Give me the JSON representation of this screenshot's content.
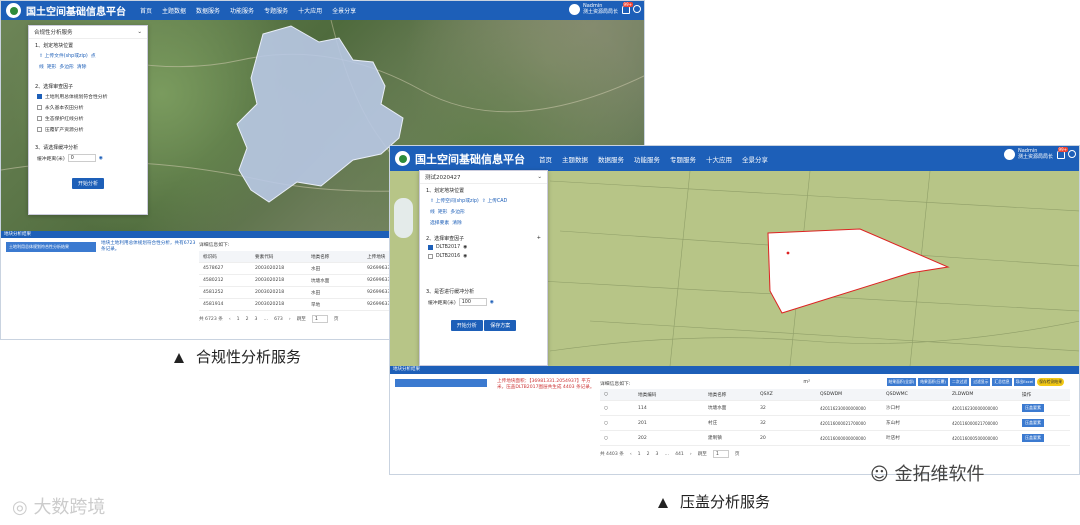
{
  "app_title": "国土空间基础信息平台",
  "nav": [
    "首页",
    "主题数据",
    "数据服务",
    "功能服务",
    "专题服务",
    "十大应用",
    "全景分享"
  ],
  "user": {
    "name": "Nadmin",
    "org": "测土资源局局长"
  },
  "notify_count": "99+",
  "panel1": {
    "title": "合规性分析服务",
    "s1": "1、划定地块位置",
    "upload": "上传文件(shp或zip)",
    "pt": "点",
    "tools": [
      "线",
      "矩形",
      "多边形",
      "清除"
    ],
    "s2": "2、选择审查因子",
    "factors": [
      "土地利用总体规划符合性分析",
      "永久基本农田分析",
      "生态保护红线分析",
      "压覆矿产资源分析"
    ],
    "s3": "3、请选择缓冲分析",
    "buffer_label": "缓冲距离(米)",
    "buffer_value": "0",
    "run": "开始分析"
  },
  "res1": {
    "title": "地块分析结果",
    "left_item": "土地利用总体规划符合性分析结果",
    "stat": "地块土地利用总体规划符合性分析，共有6723条记录。",
    "detail": "详细信息如下:",
    "headers": [
      "标识码",
      "要素代码",
      "地类名称",
      "上传地块"
    ],
    "rows": [
      [
        "4578627",
        "2003020218",
        "水田",
        "92699633"
      ],
      [
        "4580212",
        "2003020218",
        "坑塘水面",
        "92699633"
      ],
      [
        "4581252",
        "2003020218",
        "水田",
        "92699633"
      ],
      [
        "4581914",
        "2003020218",
        "旱地",
        "92699633"
      ]
    ],
    "total": "共 6723 条",
    "pages": [
      "1",
      "2",
      "3",
      "…",
      "673"
    ],
    "goto": "跳至",
    "page_val": "1",
    "unit": "页"
  },
  "panel2": {
    "title": "测试2020427",
    "s1": "1、划定地块位置",
    "upload": "上传空间(shp或zip)",
    "upload_cad": "上传CAD",
    "tools": [
      "线",
      "矩形",
      "多边形"
    ],
    "pick": "选择要素",
    "clear": "清除",
    "s2": "2、选择审查因子",
    "factors": [
      "DLTB2017",
      "DLTB2016"
    ],
    "s3": "3、是否进行缓冲分析",
    "buffer_label": "缓冲距离(米)",
    "buffer_value": "100",
    "run": "开始分析",
    "save": "保存方案"
  },
  "scale2": "500 米",
  "res2": {
    "title": "地块分析结果",
    "stat": "上传地块面积：【36981331.2054937】平方米，压盖DLTB2017图层共生成 4403 条记录。",
    "detail": "详细信息如下:",
    "unit_sel": "m²",
    "tbtns": [
      "结果面积(全部)",
      "结果面积(压覆)",
      "二次过滤",
      "过滤显示",
      "汇总信息",
      "导出Excel",
      "保存检测结果"
    ],
    "headers": [
      "地类编码",
      "地类名称",
      "QSXZ",
      "QSDWDM",
      "QSDWMC",
      "ZLDWDM",
      "操作"
    ],
    "rows": [
      [
        "114",
        "坑塘水面",
        "32",
        "420116230000000000",
        "沙口村",
        "420116230000000000",
        "压盖要素"
      ],
      [
        "201",
        "村庄",
        "32",
        "420116000021700000",
        "东山村",
        "420116000021700000",
        "压盖要素"
      ],
      [
        "202",
        "建制镇",
        "20",
        "420116000000000000",
        "叶店村",
        "420116000500000000",
        "压盖要素"
      ]
    ],
    "total": "共 4403 条",
    "pages": [
      "1",
      "2",
      "3",
      "…",
      "441"
    ],
    "goto": "跳至",
    "page_val": "1",
    "unit": "页"
  },
  "cap1": "合规性分析服务",
  "cap2": "压盖分析服务",
  "wm_left": "大数跨境",
  "wm_right": "金拓维软件"
}
